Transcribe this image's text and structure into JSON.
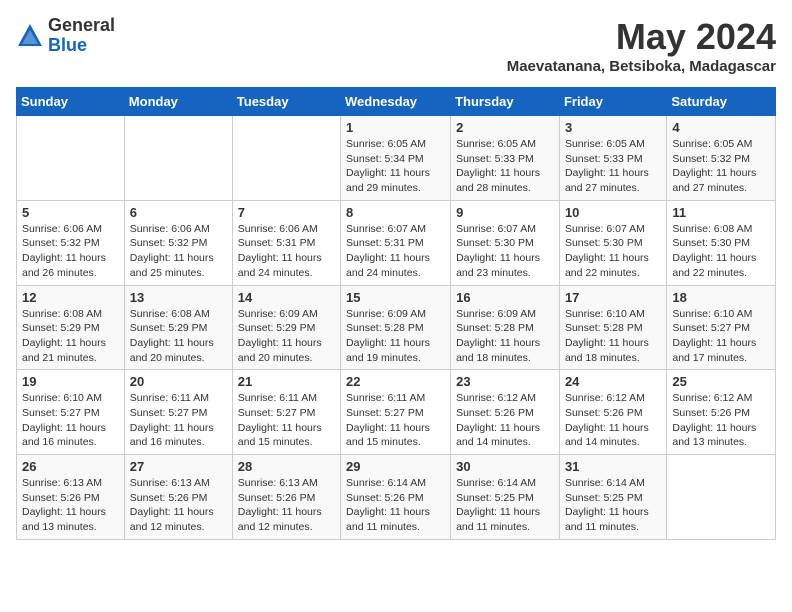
{
  "logo": {
    "general": "General",
    "blue": "Blue"
  },
  "title": "May 2024",
  "location": "Maevatanana, Betsiboka, Madagascar",
  "days_of_week": [
    "Sunday",
    "Monday",
    "Tuesday",
    "Wednesday",
    "Thursday",
    "Friday",
    "Saturday"
  ],
  "weeks": [
    [
      {
        "day": "",
        "info": ""
      },
      {
        "day": "",
        "info": ""
      },
      {
        "day": "",
        "info": ""
      },
      {
        "day": "1",
        "info": "Sunrise: 6:05 AM\nSunset: 5:34 PM\nDaylight: 11 hours and 29 minutes."
      },
      {
        "day": "2",
        "info": "Sunrise: 6:05 AM\nSunset: 5:33 PM\nDaylight: 11 hours and 28 minutes."
      },
      {
        "day": "3",
        "info": "Sunrise: 6:05 AM\nSunset: 5:33 PM\nDaylight: 11 hours and 27 minutes."
      },
      {
        "day": "4",
        "info": "Sunrise: 6:05 AM\nSunset: 5:32 PM\nDaylight: 11 hours and 27 minutes."
      }
    ],
    [
      {
        "day": "5",
        "info": "Sunrise: 6:06 AM\nSunset: 5:32 PM\nDaylight: 11 hours and 26 minutes."
      },
      {
        "day": "6",
        "info": "Sunrise: 6:06 AM\nSunset: 5:32 PM\nDaylight: 11 hours and 25 minutes."
      },
      {
        "day": "7",
        "info": "Sunrise: 6:06 AM\nSunset: 5:31 PM\nDaylight: 11 hours and 24 minutes."
      },
      {
        "day": "8",
        "info": "Sunrise: 6:07 AM\nSunset: 5:31 PM\nDaylight: 11 hours and 24 minutes."
      },
      {
        "day": "9",
        "info": "Sunrise: 6:07 AM\nSunset: 5:30 PM\nDaylight: 11 hours and 23 minutes."
      },
      {
        "day": "10",
        "info": "Sunrise: 6:07 AM\nSunset: 5:30 PM\nDaylight: 11 hours and 22 minutes."
      },
      {
        "day": "11",
        "info": "Sunrise: 6:08 AM\nSunset: 5:30 PM\nDaylight: 11 hours and 22 minutes."
      }
    ],
    [
      {
        "day": "12",
        "info": "Sunrise: 6:08 AM\nSunset: 5:29 PM\nDaylight: 11 hours and 21 minutes."
      },
      {
        "day": "13",
        "info": "Sunrise: 6:08 AM\nSunset: 5:29 PM\nDaylight: 11 hours and 20 minutes."
      },
      {
        "day": "14",
        "info": "Sunrise: 6:09 AM\nSunset: 5:29 PM\nDaylight: 11 hours and 20 minutes."
      },
      {
        "day": "15",
        "info": "Sunrise: 6:09 AM\nSunset: 5:28 PM\nDaylight: 11 hours and 19 minutes."
      },
      {
        "day": "16",
        "info": "Sunrise: 6:09 AM\nSunset: 5:28 PM\nDaylight: 11 hours and 18 minutes."
      },
      {
        "day": "17",
        "info": "Sunrise: 6:10 AM\nSunset: 5:28 PM\nDaylight: 11 hours and 18 minutes."
      },
      {
        "day": "18",
        "info": "Sunrise: 6:10 AM\nSunset: 5:27 PM\nDaylight: 11 hours and 17 minutes."
      }
    ],
    [
      {
        "day": "19",
        "info": "Sunrise: 6:10 AM\nSunset: 5:27 PM\nDaylight: 11 hours and 16 minutes."
      },
      {
        "day": "20",
        "info": "Sunrise: 6:11 AM\nSunset: 5:27 PM\nDaylight: 11 hours and 16 minutes."
      },
      {
        "day": "21",
        "info": "Sunrise: 6:11 AM\nSunset: 5:27 PM\nDaylight: 11 hours and 15 minutes."
      },
      {
        "day": "22",
        "info": "Sunrise: 6:11 AM\nSunset: 5:27 PM\nDaylight: 11 hours and 15 minutes."
      },
      {
        "day": "23",
        "info": "Sunrise: 6:12 AM\nSunset: 5:26 PM\nDaylight: 11 hours and 14 minutes."
      },
      {
        "day": "24",
        "info": "Sunrise: 6:12 AM\nSunset: 5:26 PM\nDaylight: 11 hours and 14 minutes."
      },
      {
        "day": "25",
        "info": "Sunrise: 6:12 AM\nSunset: 5:26 PM\nDaylight: 11 hours and 13 minutes."
      }
    ],
    [
      {
        "day": "26",
        "info": "Sunrise: 6:13 AM\nSunset: 5:26 PM\nDaylight: 11 hours and 13 minutes."
      },
      {
        "day": "27",
        "info": "Sunrise: 6:13 AM\nSunset: 5:26 PM\nDaylight: 11 hours and 12 minutes."
      },
      {
        "day": "28",
        "info": "Sunrise: 6:13 AM\nSunset: 5:26 PM\nDaylight: 11 hours and 12 minutes."
      },
      {
        "day": "29",
        "info": "Sunrise: 6:14 AM\nSunset: 5:26 PM\nDaylight: 11 hours and 11 minutes."
      },
      {
        "day": "30",
        "info": "Sunrise: 6:14 AM\nSunset: 5:25 PM\nDaylight: 11 hours and 11 minutes."
      },
      {
        "day": "31",
        "info": "Sunrise: 6:14 AM\nSunset: 5:25 PM\nDaylight: 11 hours and 11 minutes."
      },
      {
        "day": "",
        "info": ""
      }
    ]
  ]
}
